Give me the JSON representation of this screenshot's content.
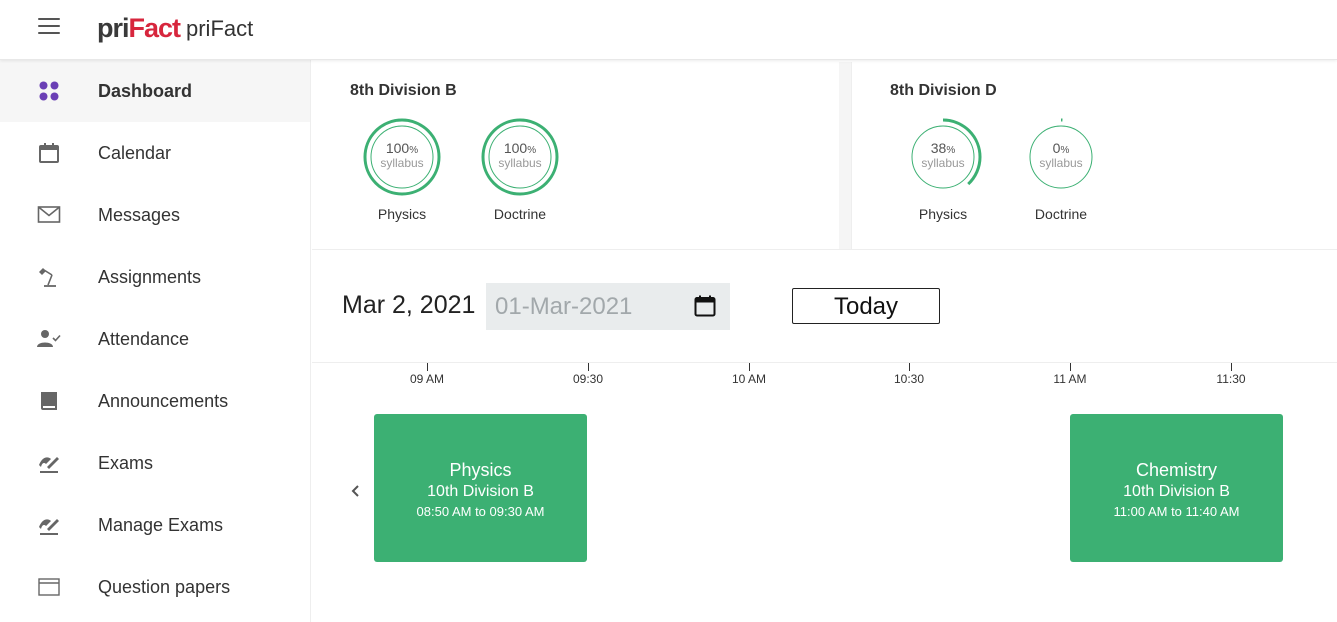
{
  "header": {
    "logo_pri": "pri",
    "logo_fact": "Fact",
    "brand": "priFact"
  },
  "sidebar": {
    "items": [
      {
        "label": "Dashboard",
        "icon": "dashboard-icon",
        "active": true
      },
      {
        "label": "Calendar",
        "icon": "calendar-icon"
      },
      {
        "label": "Messages",
        "icon": "envelope-icon"
      },
      {
        "label": "Assignments",
        "icon": "desk-lamp-icon"
      },
      {
        "label": "Attendance",
        "icon": "person-check-icon"
      },
      {
        "label": "Announcements",
        "icon": "book-icon"
      },
      {
        "label": "Exams",
        "icon": "exam-pen-icon"
      },
      {
        "label": "Manage Exams",
        "icon": "exam-pen-icon"
      },
      {
        "label": "Question papers",
        "icon": "window-icon"
      }
    ]
  },
  "cards": [
    {
      "title": "8th Division B",
      "subjects": [
        {
          "percent": "100",
          "unit": "%",
          "sub": "syllabus",
          "label": "Physics",
          "progress": 1.0
        },
        {
          "percent": "100",
          "unit": "%",
          "sub": "syllabus",
          "label": "Doctrine",
          "progress": 1.0
        }
      ]
    },
    {
      "title": "8th Division D",
      "subjects": [
        {
          "percent": "38",
          "unit": "%",
          "sub": "syllabus",
          "label": "Physics",
          "progress": 0.38
        },
        {
          "percent": "0",
          "unit": "%",
          "sub": "syllabus",
          "label": "Doctrine",
          "progress": 0.0
        }
      ]
    }
  ],
  "date_bar": {
    "date_text": "Mar 2, 2021",
    "date_input_value": "01-Mar-2021",
    "today_label": "Today"
  },
  "timeline": {
    "ticks": [
      "09 AM",
      "09:30",
      "10 AM",
      "10:30",
      "11 AM",
      "11:30"
    ],
    "events": [
      {
        "title": "Physics",
        "class": "10th Division B",
        "time": "08:50 AM to 09:30 AM"
      },
      {
        "title": "Chemistry",
        "class": "10th Division B",
        "time": "11:00 AM to 11:40 AM"
      }
    ]
  },
  "colors": {
    "accent": "#3cb073",
    "ring": "#3cb073",
    "logo_red": "#d7263d",
    "dashboard_icon": "#6a3fb5"
  }
}
